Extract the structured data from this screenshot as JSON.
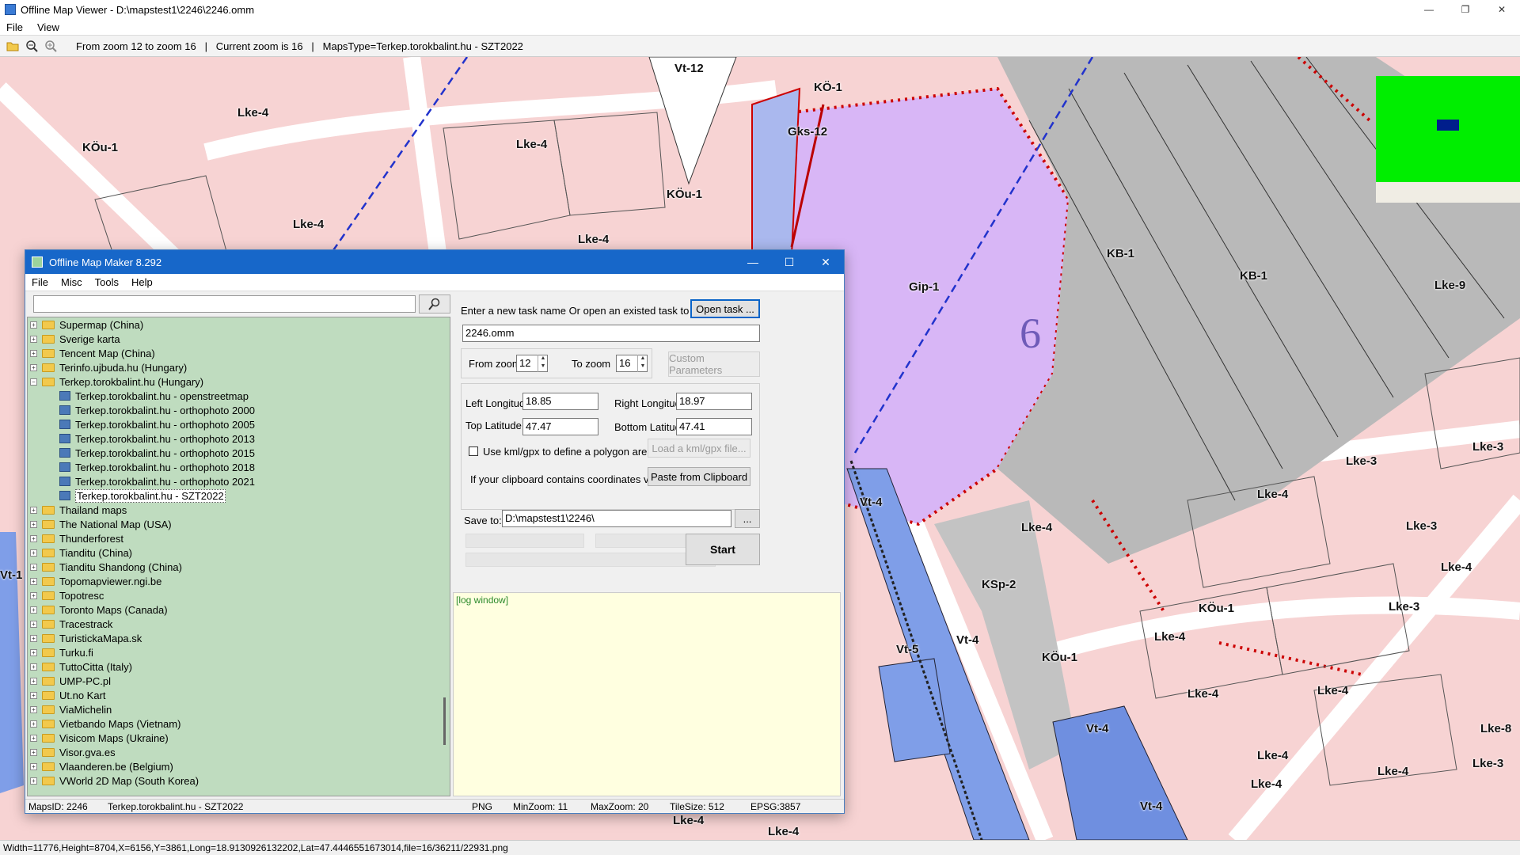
{
  "app": {
    "title": "Offline Map Viewer - D:\\mapstest1\\2246\\2246.omm",
    "menu": [
      "File",
      "View"
    ],
    "window_controls": [
      "—",
      "❐",
      "✕"
    ]
  },
  "toolbar": {
    "icons": [
      "folder-open-icon",
      "zoom-out-icon",
      "zoom-in-icon"
    ],
    "info": "From zoom 12 to zoom 16   |   Current zoom is 16   |   MapsType=Terkep.torokbalint.hu - SZT2022"
  },
  "map": {
    "zone_labels": [
      "Lke-4",
      "KÖu-1",
      "Lke-4",
      "Lke-4",
      "Lke-4",
      "KÖu-1",
      "Vt-12",
      "KÖ-1",
      "Gks-12",
      "KB-1",
      "KB-1",
      "Gip-1",
      "Lke-9",
      "Lke-3",
      "Lke-4",
      "Lke-3",
      "Lke-4",
      "KSp-2",
      "KÖu-1",
      "Lke-4",
      "Lke-3",
      "Vt-4",
      "Vt-5",
      "Vt-4",
      "KÖu-1",
      "Vt-4",
      "Lke-4",
      "Lke-4",
      "Lke-4",
      "Lke-8",
      "Lke-3",
      "Vt-4",
      "Lke-4",
      "Lke-4",
      "Vt-1",
      "Lke-4",
      "Lke-4",
      "Lke-4",
      "Lke-3"
    ],
    "big_number": "6",
    "colors": {
      "residential": "#f7c6c6",
      "industrial_purple": "#d6b3f5",
      "grey_zone": "#b8b8b8",
      "blue_zone": "#7f9ee8",
      "overview_green": "#00ee00"
    }
  },
  "status": {
    "text": "Width=11776,Height=8704,X=6156,Y=3861,Long=18.9130926132202,Lat=47.4446551673014,file=16/36211/22931.png"
  },
  "dialog": {
    "title": "Offline Map Maker 8.292",
    "menu": [
      "File",
      "Misc",
      "Tools",
      "Help"
    ],
    "window_controls": [
      "—",
      "☐",
      "✕"
    ],
    "search": {
      "value": "",
      "placeholder": ""
    },
    "tree": [
      {
        "label": "Supermap (China)",
        "level": 0,
        "expanded": false
      },
      {
        "label": "Sverige karta",
        "level": 0,
        "expanded": false
      },
      {
        "label": "Tencent Map (China)",
        "level": 0,
        "expanded": false
      },
      {
        "label": "Terinfo.ujbuda.hu (Hungary)",
        "level": 0,
        "expanded": false
      },
      {
        "label": "Terkep.torokbalint.hu (Hungary)",
        "level": 0,
        "expanded": true
      },
      {
        "label": "Terkep.torokbalint.hu - openstreetmap",
        "level": 1
      },
      {
        "label": "Terkep.torokbalint.hu - orthophoto 2000",
        "level": 1
      },
      {
        "label": "Terkep.torokbalint.hu - orthophoto 2005",
        "level": 1
      },
      {
        "label": "Terkep.torokbalint.hu - orthophoto 2013",
        "level": 1
      },
      {
        "label": "Terkep.torokbalint.hu - orthophoto 2015",
        "level": 1
      },
      {
        "label": "Terkep.torokbalint.hu - orthophoto 2018",
        "level": 1
      },
      {
        "label": "Terkep.torokbalint.hu - orthophoto 2021",
        "level": 1
      },
      {
        "label": "Terkep.torokbalint.hu - SZT2022",
        "level": 1,
        "selected": true
      },
      {
        "label": "Thailand maps",
        "level": 0,
        "expanded": false
      },
      {
        "label": "The National Map (USA)",
        "level": 0,
        "expanded": false
      },
      {
        "label": "Thunderforest",
        "level": 0,
        "expanded": false
      },
      {
        "label": "Tianditu (China)",
        "level": 0,
        "expanded": false
      },
      {
        "label": "Tianditu Shandong (China)",
        "level": 0,
        "expanded": false
      },
      {
        "label": "Topomapviewer.ngi.be",
        "level": 0,
        "expanded": false
      },
      {
        "label": "Topotresc",
        "level": 0,
        "expanded": false
      },
      {
        "label": "Toronto Maps (Canada)",
        "level": 0,
        "expanded": false
      },
      {
        "label": "Tracestrack",
        "level": 0,
        "expanded": false
      },
      {
        "label": "TuristickaMapa.sk",
        "level": 0,
        "expanded": false
      },
      {
        "label": "Turku.fi",
        "level": 0,
        "expanded": false
      },
      {
        "label": "TuttoCitta (Italy)",
        "level": 0,
        "expanded": false
      },
      {
        "label": "UMP-PC.pl",
        "level": 0,
        "expanded": false
      },
      {
        "label": "Ut.no Kart",
        "level": 0,
        "expanded": false
      },
      {
        "label": "ViaMichelin",
        "level": 0,
        "expanded": false
      },
      {
        "label": "Vietbando Maps (Vietnam)",
        "level": 0,
        "expanded": false
      },
      {
        "label": "Visicom Maps (Ukraine)",
        "level": 0,
        "expanded": false
      },
      {
        "label": "Visor.gva.es",
        "level": 0,
        "expanded": false
      },
      {
        "label": "Vlaanderen.be (Belgium)",
        "level": 0,
        "expanded": false
      },
      {
        "label": "VWorld 2D Map (South Korea)",
        "level": 0,
        "expanded": false
      }
    ],
    "task": {
      "prompt": "Enter a new task name Or open an existed task to continue:",
      "open_button": "Open task ...",
      "task_name": "2246.omm"
    },
    "zoom": {
      "from_label": "From zoom",
      "from_value": "12",
      "to_label": "To zoom",
      "to_value": "16",
      "custom_button": "Custom Parameters"
    },
    "bounds": {
      "left_lon_label": "Left Longitude",
      "left_lon": "18.85",
      "right_lon_label": "Right Longitude",
      "right_lon": "18.97",
      "top_lat_label": "Top Latitude",
      "top_lat": "47.47",
      "bottom_lat_label": "Bottom Latitude",
      "bottom_lat": "47.41",
      "kml_label": "Use kml/gpx to define a polygon area",
      "kml_checked": false,
      "kml_button": "Load a kml/gpx file...",
      "clipboard_label": "If your clipboard contains coordinates values:",
      "clipboard_button": "Paste from Clipboard"
    },
    "save": {
      "label": "Save to:",
      "path": "D:\\mapstest1\\2246\\",
      "browse_button": "...",
      "start_button": "Start"
    },
    "log": "[log window]",
    "status": {
      "maps_id": "MapsID: 2246",
      "map_name": "Terkep.torokbalint.hu - SZT2022",
      "format": "PNG",
      "min_zoom": "MinZoom: 11",
      "max_zoom": "MaxZoom: 20",
      "tile_size": "TileSize: 512",
      "epsg": "EPSG:3857"
    }
  }
}
